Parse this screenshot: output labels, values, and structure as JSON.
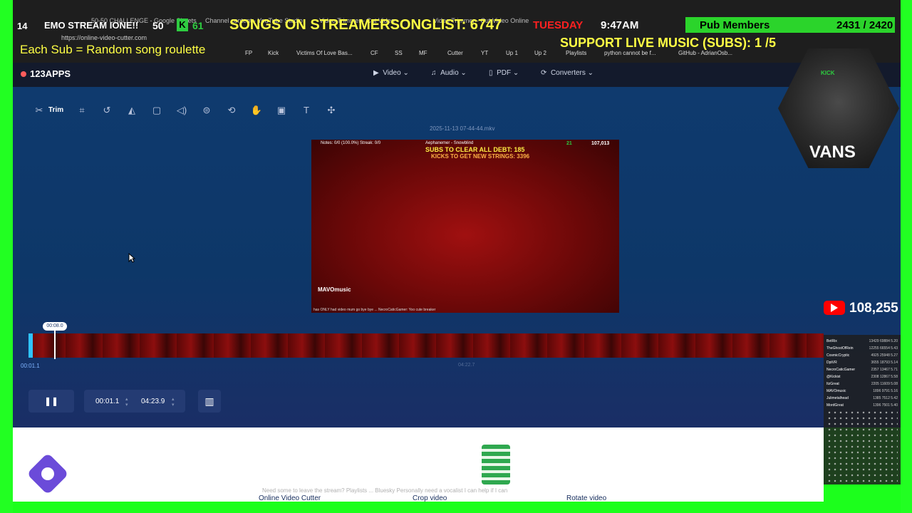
{
  "overlay": {
    "emo_title": "EMO STREAM IONE!!",
    "emo_num": "50",
    "count_left": "14",
    "kick_badge": "K",
    "kick_num": "61",
    "songs_text": "SONGS ON STREAMERSONGLIST: 6747",
    "day": "TUESDAY",
    "time": "9:47AM",
    "pub_label": "Pub Members",
    "pub_count": "2431 / 2420",
    "support_text": "SUPPORT LIVE MUSIC (SUBS): 1  /5",
    "roulette_text": "Each Sub = Random song roulette",
    "url": "https://online-video-cutter.com",
    "tabs": [
      "50-50 CHALLENGE - Google Sheets",
      "Channel content - YouTube Studio",
      "Video Trimmer - Cut Video",
      "Video Trimmer - Cut Video Online"
    ]
  },
  "bookmarks": [
    "FP",
    "Kick",
    "Victims Of Love Bas...",
    "CF",
    "SS",
    "MF",
    "Cutter",
    "YT",
    "Up 1",
    "Up 2",
    "Playlists",
    "python cannot be f...",
    "GitHub - AdrianOsb..."
  ],
  "app": {
    "logo": "123APPS",
    "nav": [
      {
        "label": "Video",
        "icon": "video-icon"
      },
      {
        "label": "Audio",
        "icon": "music-icon"
      },
      {
        "label": "PDF",
        "icon": "document-icon"
      },
      {
        "label": "Converters",
        "icon": "convert-icon"
      }
    ]
  },
  "toolbar": {
    "trim_label": "Trim"
  },
  "editor": {
    "filename": "2025-11-13 07-44-44.mkv",
    "timeline_start": "00:01.1",
    "timeline_end": "04:22.7",
    "playhead_label": "00:08.0",
    "start_time": "00:01.1",
    "end_time": "04:23.9"
  },
  "video_frame": {
    "info": "Notes: 0/0 (100.0%)  Streak: 0/0",
    "track": "Aephanemer - Snowblind",
    "subs": "SUBS TO CLEAR ALL DEBT: 185",
    "kicks": "KICKS TO GET NEW STRINGS: 3396",
    "kick_count": "21",
    "yt_count": "107,013",
    "channel": "MAVOmusic",
    "chat": "has ONLY had video mum go bye bye ... NecroCaticGamer: Yoo cute breaker"
  },
  "footer": {
    "links": [
      "Online Video Cutter",
      "Crop video",
      "Rotate video"
    ],
    "ticker": "Need some to leave the stream? Playlists ... Bluesky Personally need a vocalist I can help if I can"
  },
  "stream": {
    "webcam_text": "VANS",
    "cap_text": "KICK",
    "yt_subs": "108,255",
    "leaderboard": [
      {
        "name": "BetRix",
        "vals": "13429 69884  5.20"
      },
      {
        "name": "TheGhostOfRein",
        "vals": "12255 66554  5.43"
      },
      {
        "name": "CosmicCryptic",
        "vals": "4925 25948  5.27"
      },
      {
        "name": "DptVR",
        "vals": "3655 18793  5.14"
      },
      {
        "name": "NecroCaticGamer",
        "vals": "2357 13467  5.71"
      },
      {
        "name": "@Kickist",
        "vals": "2308 12867  5.58"
      },
      {
        "name": "ItzGreat",
        "vals": "2205 11609  5.08"
      },
      {
        "name": "MAVOmusic",
        "vals": "1896 9791  5.16"
      },
      {
        "name": "Julimetalhead",
        "vals": "1385 7512  5.42"
      },
      {
        "name": "MordGreat",
        "vals": "1396 7501  5.40"
      }
    ]
  }
}
